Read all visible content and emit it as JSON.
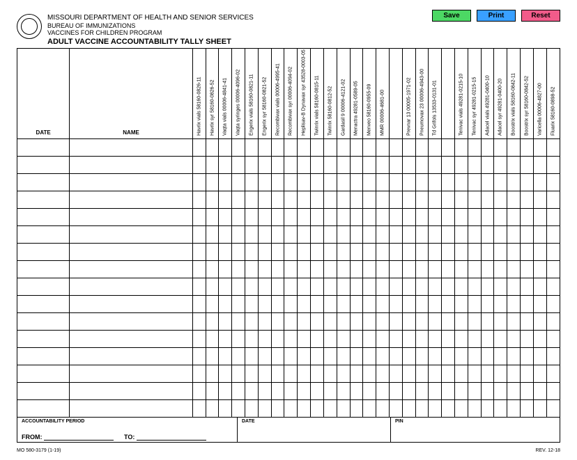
{
  "buttons": {
    "save": "Save",
    "print": "Print",
    "reset": "Reset"
  },
  "header": {
    "dept": "MISSOURI DEPARTMENT OF HEALTH AND SENIOR SERVICES",
    "bureau": "BUREAU OF IMMUNIZATIONS",
    "program": "VACCINES FOR CHILDREN PROGRAM",
    "title": "ADULT VACCINE ACCOUNTABILITY TALLY SHEET"
  },
  "columns": {
    "date": "DATE",
    "name": "NAME",
    "vaccines": [
      "Havrix vials 58160-0826-11",
      "Havrix syr 58160-0826-52",
      "Vaqta vials 00006-4841-41",
      "Vaqta syringes 00006-4096-02",
      "Engerix vials 58160-0821-11",
      "Engerix syr 58160-0821-52",
      "Recombivax vials 00006-4995-41",
      "Recombivax syr 00006-4094-02",
      "Heplisav-B Dynavax syr 43528-0003-05",
      "Twinrix vials 58160-0815-11",
      "Twinrix 58160-0812-52",
      "Gardasil 9 00006-4121-02",
      "Menactra 49281-0589-05",
      "Menveo 58160-0955-09",
      "MMR 00006-4681-00",
      "Prevnar 13 00005-1971-02",
      "Pneumovax 23 00006-4943-00",
      "Td Grifols 13533-0131-01",
      "Tenivac vials 49281-0215-10",
      "Tenivac syr 49281-0215-15",
      "Adacel vials 49281-0400-10",
      "Adacel syr 49281-0400-20",
      "Boostrix vials 58160-0842-11",
      "Boostrix syr 58160-0842-52",
      "Varicella 00006-4827-00",
      "Fluarix 58160-0898-52"
    ]
  },
  "footer": {
    "accountability": "ACCOUNTABILITY PERIOD",
    "date": "DATE",
    "pin": "PIN",
    "from": "FROM:",
    "to": "TO:"
  },
  "meta": {
    "form_no": "MO 580-3179 (1-19)",
    "rev": "REV. 12-18"
  },
  "row_count": 16,
  "gap_after": [
    14,
    17
  ]
}
